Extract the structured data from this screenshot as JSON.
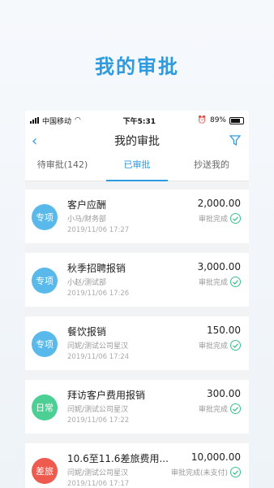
{
  "headline": "我的审批",
  "status_bar": {
    "carrier": "中国移动",
    "time": "下午5:31",
    "battery": "89%"
  },
  "nav": {
    "title": "我的审批"
  },
  "tabs": [
    {
      "label": "待审批(142)"
    },
    {
      "label": "已审批"
    },
    {
      "label": "抄送我的"
    }
  ],
  "colors": {
    "accent": "#2e9be0",
    "type_zhuanxiang": "#59b9ea",
    "type_richang": "#4ccf94",
    "type_chalv": "#ef5a4e",
    "check": "#3bbf8a"
  },
  "items": [
    {
      "badge": "专项",
      "title": "客户应酬",
      "sub": "小马/财务部",
      "time": "2019/11/06 17:27",
      "amount": "2,000.00",
      "status": "审批完成"
    },
    {
      "badge": "专项",
      "title": "秋季招聘报销",
      "sub": "小赵/测试部",
      "time": "2019/11/06 17:26",
      "amount": "3,000.00",
      "status": "审批完成"
    },
    {
      "badge": "专项",
      "title": "餐饮报销",
      "sub": "闫妮/测试公司星汉",
      "time": "2019/11/06 17:24",
      "amount": "150.00",
      "status": "审批完成"
    },
    {
      "badge": "日常",
      "title": "拜访客户费用报销",
      "sub": "闫妮/测试公司星汉",
      "time": "2019/11/06 17:22",
      "amount": "300.00",
      "status": "审批完成"
    },
    {
      "badge": "差旅",
      "title": "10.6至11.6差旅费用...",
      "sub": "闫妮/测试公司星汉",
      "time": "2019/11/06 17:17",
      "amount": "10,000.00",
      "status": "审批完成(未支付)"
    }
  ]
}
